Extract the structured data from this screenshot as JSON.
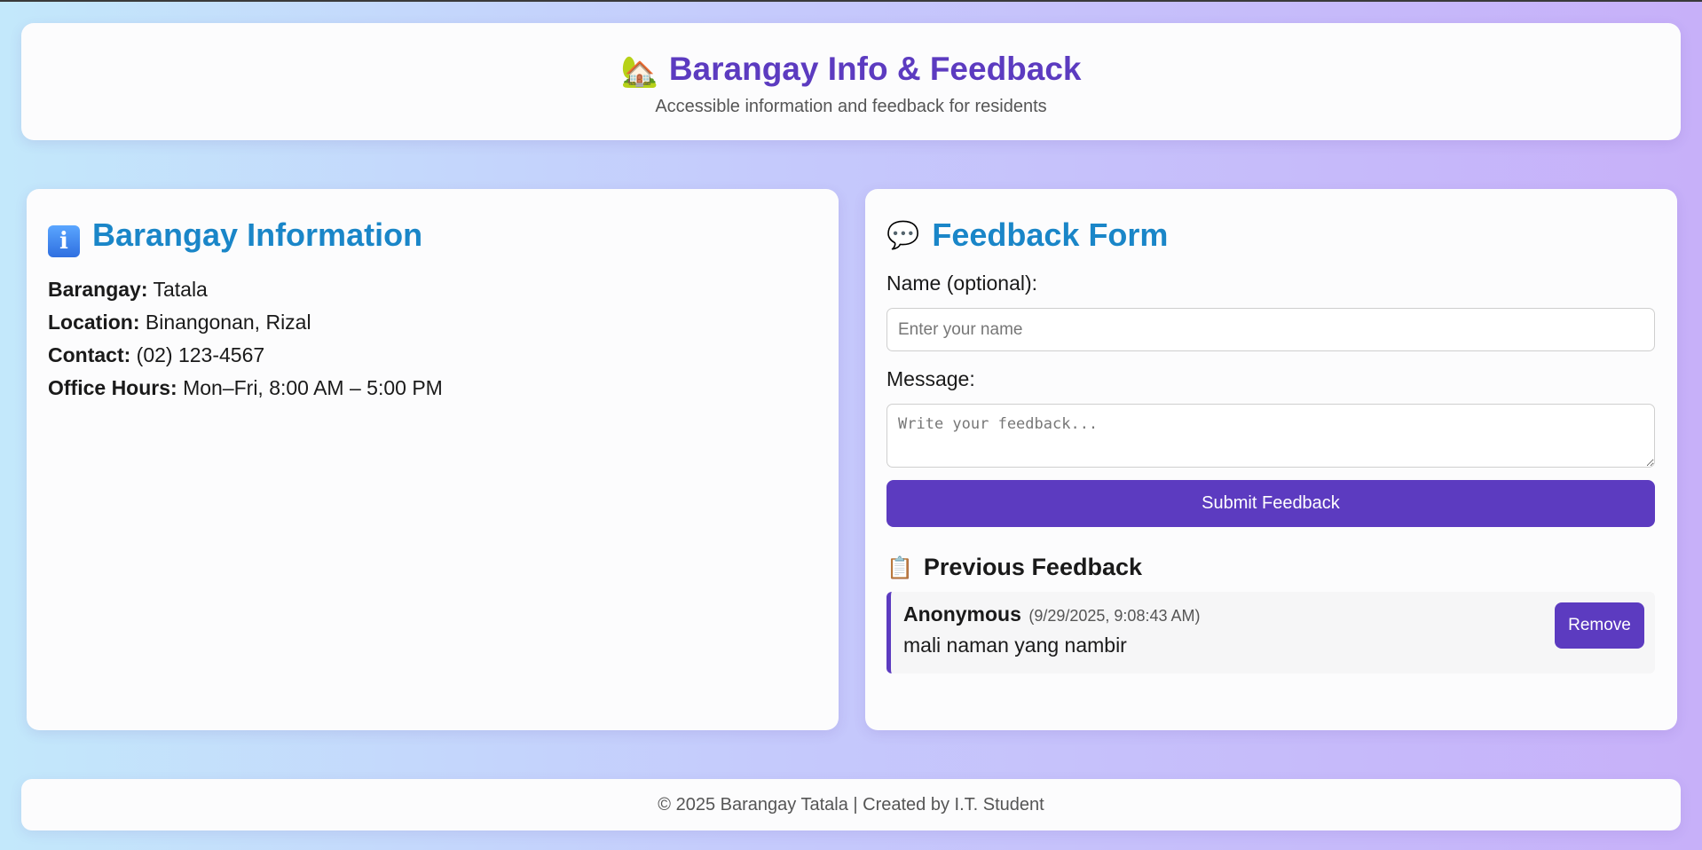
{
  "header": {
    "icon": "house-with-garden-icon",
    "emoji": "🏡",
    "title": "Barangay Info & Feedback",
    "subtitle": "Accessible information and feedback for residents"
  },
  "info_card": {
    "icon": "information-icon",
    "icon_glyph": "i",
    "title": "Barangay Information",
    "rows": [
      {
        "label": "Barangay:",
        "value": "Tatala"
      },
      {
        "label": "Location:",
        "value": "Binangonan, Rizal"
      },
      {
        "label": "Contact:",
        "value": "(02) 123-4567"
      },
      {
        "label": "Office Hours:",
        "value": "Mon–Fri, 8:00 AM – 5:00 PM"
      }
    ]
  },
  "feedback_card": {
    "icon": "speech-balloon-icon",
    "emoji": "💬",
    "title": "Feedback Form",
    "name_label": "Name (optional):",
    "name_placeholder": "Enter your name",
    "name_value": "",
    "message_label": "Message:",
    "message_placeholder": "Write your feedback...",
    "message_value": "",
    "submit_label": "Submit Feedback"
  },
  "previous_feedback": {
    "icon": "clipboard-icon",
    "emoji": "📋",
    "title": "Previous Feedback",
    "items": [
      {
        "author": "Anonymous",
        "timestamp": "(9/29/2025, 9:08:43 AM)",
        "message": "mali naman yang nambir",
        "remove_label": "Remove"
      }
    ]
  },
  "footer": {
    "text": "© 2025 Barangay Tatala | Created by I.T. Student"
  },
  "colors": {
    "accent": "#5c3bc0",
    "heading_blue": "#1a86c8",
    "card_bg": "#fcfcfd"
  }
}
